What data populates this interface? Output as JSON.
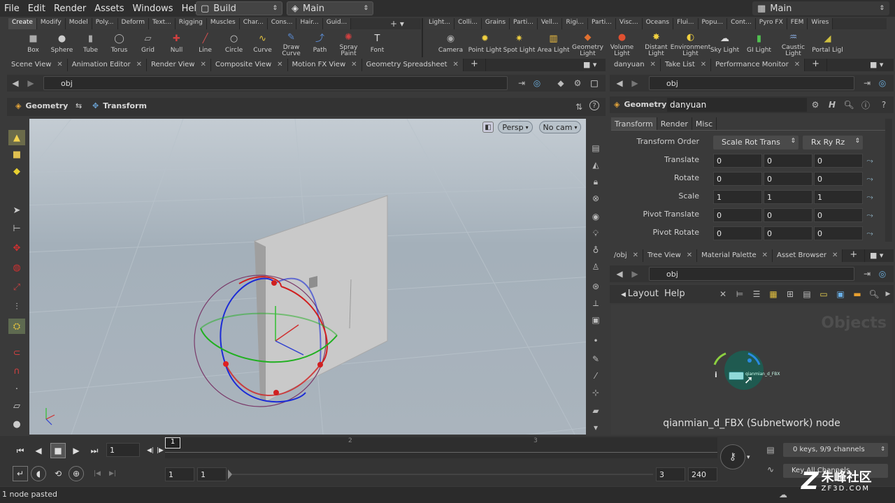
{
  "menubar": {
    "items": [
      "File",
      "Edit",
      "Render",
      "Assets",
      "Windows",
      "Help"
    ],
    "desktop": "Build",
    "network": "Main",
    "right_desktop": "Main"
  },
  "shelf_left": {
    "tabs": [
      "Create",
      "Modify",
      "Model",
      "Poly...",
      "Deform",
      "Text...",
      "Rigging",
      "Muscles",
      "Char...",
      "Cons...",
      "Hair...",
      "Guid..."
    ],
    "tools": [
      {
        "label": "Box",
        "icon": "box-icon"
      },
      {
        "label": "Sphere",
        "icon": "sphere-icon"
      },
      {
        "label": "Tube",
        "icon": "tube-icon"
      },
      {
        "label": "Torus",
        "icon": "torus-icon"
      },
      {
        "label": "Grid",
        "icon": "grid-icon"
      },
      {
        "label": "Null",
        "icon": "null-icon"
      },
      {
        "label": "Line",
        "icon": "line-icon"
      },
      {
        "label": "Circle",
        "icon": "circle-icon"
      },
      {
        "label": "Curve",
        "icon": "curve-icon"
      },
      {
        "label": "Draw Curve",
        "icon": "draw-curve-icon"
      },
      {
        "label": "Path",
        "icon": "path-icon"
      },
      {
        "label": "Spray Paint",
        "icon": "spray-paint-icon"
      },
      {
        "label": "Font",
        "icon": "font-icon"
      }
    ]
  },
  "shelf_right": {
    "tabs": [
      "Light...",
      "Colli...",
      "Grains",
      "Parti...",
      "Vell...",
      "Rigi...",
      "Parti...",
      "Visc...",
      "Oceans",
      "Flui...",
      "Popu...",
      "Cont...",
      "Pyro FX",
      "FEM",
      "Wires"
    ],
    "tools": [
      {
        "label": "Camera",
        "icon": "camera-icon"
      },
      {
        "label": "Point Light",
        "icon": "point-light-icon"
      },
      {
        "label": "Spot Light",
        "icon": "spot-light-icon"
      },
      {
        "label": "Area Light",
        "icon": "area-light-icon"
      },
      {
        "label": "Geometry Light",
        "icon": "geometry-light-icon"
      },
      {
        "label": "Volume Light",
        "icon": "volume-light-icon"
      },
      {
        "label": "Distant Light",
        "icon": "distant-light-icon"
      },
      {
        "label": "Environment Light",
        "icon": "environment-light-icon"
      },
      {
        "label": "Sky Light",
        "icon": "sky-light-icon"
      },
      {
        "label": "GI Light",
        "icon": "gi-light-icon"
      },
      {
        "label": "Caustic Light",
        "icon": "caustic-light-icon"
      },
      {
        "label": "Portal Ligl",
        "icon": "portal-light-icon"
      }
    ]
  },
  "left_pane": {
    "tabs": [
      "Scene View",
      "Animation Editor",
      "Render View",
      "Composite View",
      "Motion FX View",
      "Geometry Spreadsheet"
    ],
    "path": "obj",
    "context_geometry": "Geometry",
    "context_transform": "Transform",
    "persp": "Persp",
    "cam": "No cam"
  },
  "right_top": {
    "tabs": [
      "danyuan",
      "Take List",
      "Performance Monitor"
    ],
    "path": "obj",
    "node_type": "Geometry",
    "node_name": "danyuan",
    "parm_tabs": [
      "Transform",
      "Render",
      "Misc"
    ],
    "transform_order_label": "Transform Order",
    "transform_order": "Scale Rot Trans",
    "rotate_order": "Rx Ry Rz",
    "parms": [
      {
        "label": "Translate",
        "v": [
          "0",
          "0",
          "0"
        ]
      },
      {
        "label": "Rotate",
        "v": [
          "0",
          "0",
          "0"
        ]
      },
      {
        "label": "Scale",
        "v": [
          "1",
          "1",
          "1"
        ]
      },
      {
        "label": "Pivot Translate",
        "v": [
          "0",
          "0",
          "0"
        ]
      },
      {
        "label": "Pivot Rotate",
        "v": [
          "0",
          "0",
          "0"
        ]
      }
    ]
  },
  "right_bottom": {
    "tabs": [
      "/obj",
      "Tree View",
      "Material Palette",
      "Asset Browser"
    ],
    "path": "obj",
    "menu_layout": "Layout",
    "menu_help": "Help",
    "watermark": "Objects",
    "node_label": "qianmian_d_FBX",
    "info": "i",
    "status": "qianmian_d_FBX (Subnetwork) node"
  },
  "timeline": {
    "frame": "1",
    "marker": "1",
    "ticks": [
      "2",
      "3"
    ],
    "start": "1",
    "start2": "1",
    "end": "3",
    "end2": "240",
    "keys": "0 keys, 9/9 channels",
    "key_all": "Key All Channels"
  },
  "statusbar": {
    "message": "1 node pasted"
  },
  "overlay": {
    "logo_cn": "朱峰社区",
    "logo_url": "ZF3D.COM"
  }
}
